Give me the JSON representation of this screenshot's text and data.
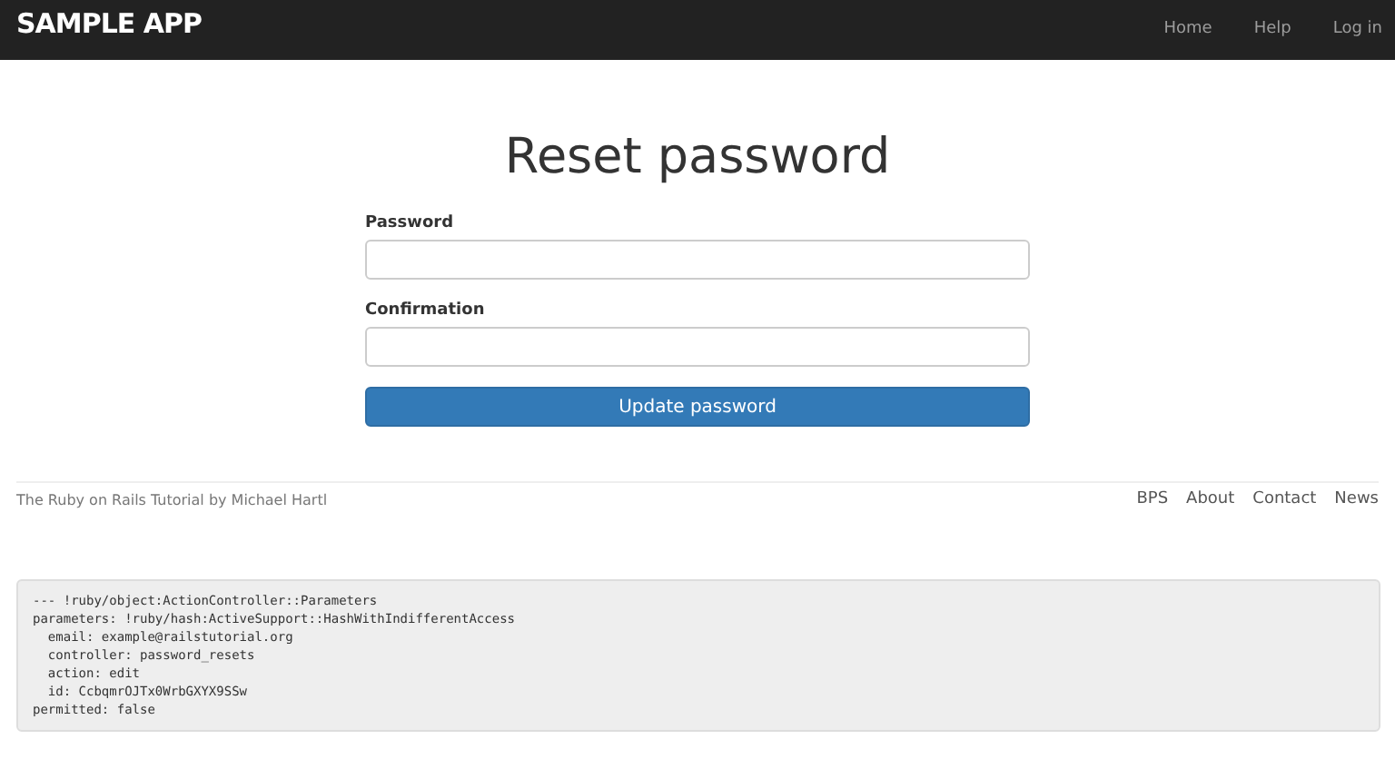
{
  "header": {
    "logo": "SAMPLE APP",
    "nav": [
      "Home",
      "Help",
      "Log in"
    ]
  },
  "form": {
    "title": "Reset password",
    "fields": [
      {
        "label": "Password"
      },
      {
        "label": "Confirmation"
      }
    ],
    "submit": "Update password"
  },
  "footer": {
    "credit": "The Ruby on Rails Tutorial by Michael Hartl",
    "links": [
      "BPS",
      "About",
      "Contact",
      "News"
    ]
  },
  "debug": [
    "--- !ruby/object:ActionController::Parameters",
    "parameters: !ruby/hash:ActiveSupport::HashWithIndifferentAccess",
    "  email: example@railstutorial.org",
    "  controller: password_resets",
    "  action: edit",
    "  id: CcbqmrOJTx0WrbGXYX9SSw",
    "permitted: false"
  ]
}
